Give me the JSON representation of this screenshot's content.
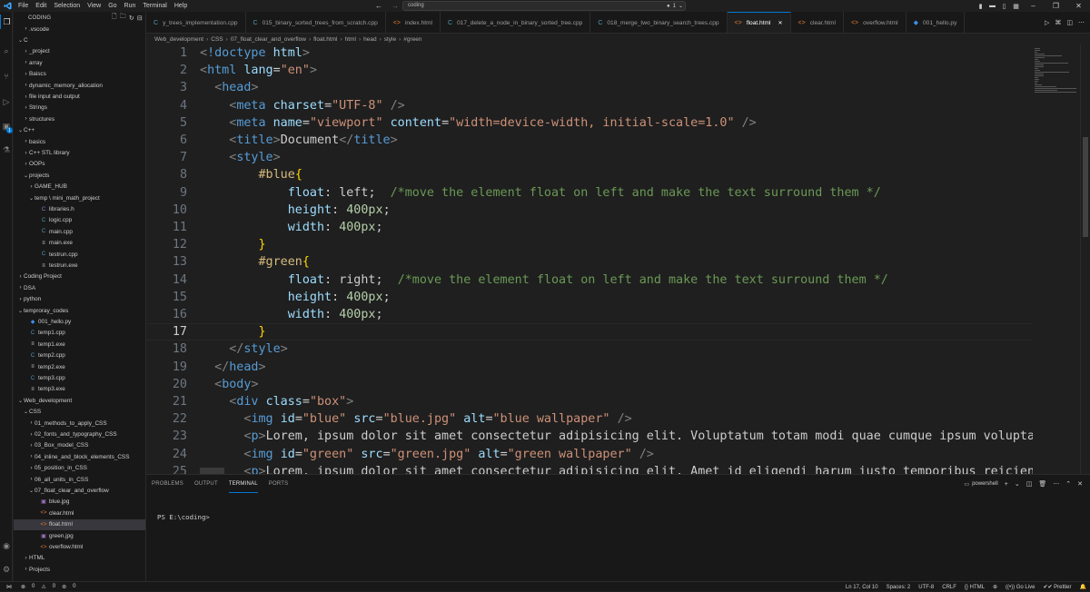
{
  "titlebar": {
    "menu": [
      "File",
      "Edit",
      "Selection",
      "View",
      "Go",
      "Run",
      "Terminal",
      "Help"
    ],
    "search_text": "coding",
    "copilot_count": "1",
    "back_icon": "arrow-left-icon",
    "forward_icon": "arrow-right-icon"
  },
  "activity": {
    "extensions_badge": "1"
  },
  "sidebar": {
    "title": "CODING",
    "items": [
      {
        "label": ".vscode",
        "depth": 1,
        "type": "folder",
        "open": false
      },
      {
        "label": "C",
        "depth": 0,
        "type": "folder",
        "open": true
      },
      {
        "label": "_project",
        "depth": 1,
        "type": "folder",
        "open": false
      },
      {
        "label": "array",
        "depth": 1,
        "type": "folder",
        "open": false
      },
      {
        "label": "Baiscs",
        "depth": 1,
        "type": "folder",
        "open": false
      },
      {
        "label": "dynamic_memory_allocation",
        "depth": 1,
        "type": "folder",
        "open": false
      },
      {
        "label": "file input and output",
        "depth": 1,
        "type": "folder",
        "open": false
      },
      {
        "label": "Strings",
        "depth": 1,
        "type": "folder",
        "open": false
      },
      {
        "label": "structures",
        "depth": 1,
        "type": "folder",
        "open": false
      },
      {
        "label": "C++",
        "depth": 0,
        "type": "folder",
        "open": true
      },
      {
        "label": "basics",
        "depth": 1,
        "type": "folder",
        "open": false
      },
      {
        "label": "C++ STL library",
        "depth": 1,
        "type": "folder",
        "open": false
      },
      {
        "label": "OOPs",
        "depth": 1,
        "type": "folder",
        "open": false
      },
      {
        "label": "projects",
        "depth": 1,
        "type": "folder",
        "open": true
      },
      {
        "label": "GAME_HUB",
        "depth": 2,
        "type": "folder",
        "open": false
      },
      {
        "label": "temp \\ mini_math_project",
        "depth": 2,
        "type": "folder",
        "open": true
      },
      {
        "label": "libraries.h",
        "depth": 3,
        "type": "h"
      },
      {
        "label": "logic.cpp",
        "depth": 3,
        "type": "cpp"
      },
      {
        "label": "main.cpp",
        "depth": 3,
        "type": "cpp"
      },
      {
        "label": "main.exe",
        "depth": 3,
        "type": "exe"
      },
      {
        "label": "testrun.cpp",
        "depth": 3,
        "type": "cpp"
      },
      {
        "label": "testrun.exe",
        "depth": 3,
        "type": "exe"
      },
      {
        "label": "Coding Project",
        "depth": 0,
        "type": "folder",
        "open": false
      },
      {
        "label": "DSA",
        "depth": 0,
        "type": "folder",
        "open": false
      },
      {
        "label": "python",
        "depth": 0,
        "type": "folder",
        "open": false
      },
      {
        "label": "temproray_codes",
        "depth": 0,
        "type": "folder",
        "open": true
      },
      {
        "label": "001_hello.py",
        "depth": 1,
        "type": "py"
      },
      {
        "label": "temp1.cpp",
        "depth": 1,
        "type": "cpp"
      },
      {
        "label": "temp1.exe",
        "depth": 1,
        "type": "exe"
      },
      {
        "label": "temp2.cpp",
        "depth": 1,
        "type": "cpp"
      },
      {
        "label": "temp2.exe",
        "depth": 1,
        "type": "exe"
      },
      {
        "label": "temp3.cpp",
        "depth": 1,
        "type": "cpp"
      },
      {
        "label": "temp3.exe",
        "depth": 1,
        "type": "exe"
      },
      {
        "label": "Web_development",
        "depth": 0,
        "type": "folder",
        "open": true
      },
      {
        "label": "CSS",
        "depth": 1,
        "type": "folder",
        "open": true
      },
      {
        "label": "01_methods_to_apply_CSS",
        "depth": 2,
        "type": "folder",
        "open": false
      },
      {
        "label": "02_fonts_and_typography_CSS",
        "depth": 2,
        "type": "folder",
        "open": false
      },
      {
        "label": "03_Box_model_CSS",
        "depth": 2,
        "type": "folder",
        "open": false
      },
      {
        "label": "04_inline_and_block_elements_CSS",
        "depth": 2,
        "type": "folder",
        "open": false
      },
      {
        "label": "05_position_in_CSS",
        "depth": 2,
        "type": "folder",
        "open": false
      },
      {
        "label": "06_all_units_in_CSS",
        "depth": 2,
        "type": "folder",
        "open": false
      },
      {
        "label": "07_float_clear_and_overflow",
        "depth": 2,
        "type": "folder",
        "open": true
      },
      {
        "label": "blue.jpg",
        "depth": 3,
        "type": "img"
      },
      {
        "label": "clear.html",
        "depth": 3,
        "type": "html"
      },
      {
        "label": "float.html",
        "depth": 3,
        "type": "html",
        "selected": true
      },
      {
        "label": "green.jpg",
        "depth": 3,
        "type": "img"
      },
      {
        "label": "overflow.html",
        "depth": 3,
        "type": "html"
      },
      {
        "label": "HTML",
        "depth": 1,
        "type": "folder",
        "open": false
      },
      {
        "label": "Projects",
        "depth": 1,
        "type": "folder",
        "open": false
      }
    ]
  },
  "tabs": [
    {
      "label": "y_trees_implementation.cpp",
      "icon": "cpp",
      "active": false
    },
    {
      "label": "015_binary_sorted_trees_from_scratch.cpp",
      "icon": "cpp",
      "active": false
    },
    {
      "label": "index.html",
      "icon": "html",
      "active": false
    },
    {
      "label": "017_delete_a_node_in_binary_sorted_tree.cpp",
      "icon": "cpp",
      "active": false
    },
    {
      "label": "018_merge_two_binary_search_trees.cpp",
      "icon": "cpp",
      "active": false
    },
    {
      "label": "float.html",
      "icon": "html",
      "active": true
    },
    {
      "label": "clear.html",
      "icon": "html",
      "active": false
    },
    {
      "label": "overflow.html",
      "icon": "html",
      "active": false
    },
    {
      "label": "001_hello.py",
      "icon": "py",
      "active": false
    }
  ],
  "breadcrumbs": [
    "Web_development",
    "CSS",
    "07_float_clear_and_overflow",
    "float.html",
    "html",
    "head",
    "style",
    "#green"
  ],
  "editor": {
    "current_line": 17,
    "lines": [
      {
        "n": "1",
        "tokens": [
          [
            "t-br",
            "<"
          ],
          [
            "t-doc",
            "!doctype"
          ],
          [
            "t-txt",
            " "
          ],
          [
            "t-attr",
            "html"
          ],
          [
            "t-br",
            ">"
          ]
        ]
      },
      {
        "n": "2",
        "tokens": [
          [
            "t-br",
            "<"
          ],
          [
            "t-tag",
            "html"
          ],
          [
            "t-txt",
            " "
          ],
          [
            "t-attr",
            "lang"
          ],
          [
            "t-txt",
            "="
          ],
          [
            "t-str",
            "\"en\""
          ],
          [
            "t-br",
            ">"
          ]
        ]
      },
      {
        "n": "3",
        "tokens": [
          [
            "t-txt",
            "  "
          ],
          [
            "t-br",
            "<"
          ],
          [
            "t-tag",
            "head"
          ],
          [
            "t-br",
            ">"
          ]
        ]
      },
      {
        "n": "4",
        "tokens": [
          [
            "t-txt",
            "    "
          ],
          [
            "t-br",
            "<"
          ],
          [
            "t-tag",
            "meta"
          ],
          [
            "t-txt",
            " "
          ],
          [
            "t-attr",
            "charset"
          ],
          [
            "t-txt",
            "="
          ],
          [
            "t-str",
            "\"UTF-8\""
          ],
          [
            "t-txt",
            " "
          ],
          [
            "t-br",
            "/>"
          ]
        ]
      },
      {
        "n": "5",
        "tokens": [
          [
            "t-txt",
            "    "
          ],
          [
            "t-br",
            "<"
          ],
          [
            "t-tag",
            "meta"
          ],
          [
            "t-txt",
            " "
          ],
          [
            "t-attr",
            "name"
          ],
          [
            "t-txt",
            "="
          ],
          [
            "t-str",
            "\"viewport\""
          ],
          [
            "t-txt",
            " "
          ],
          [
            "t-attr",
            "content"
          ],
          [
            "t-txt",
            "="
          ],
          [
            "t-str",
            "\"width=device-width, initial-scale=1.0\""
          ],
          [
            "t-txt",
            " "
          ],
          [
            "t-br",
            "/>"
          ]
        ]
      },
      {
        "n": "6",
        "tokens": [
          [
            "t-txt",
            "    "
          ],
          [
            "t-br",
            "<"
          ],
          [
            "t-tag",
            "title"
          ],
          [
            "t-br",
            ">"
          ],
          [
            "t-txt",
            "Document"
          ],
          [
            "t-br",
            "</"
          ],
          [
            "t-tag",
            "title"
          ],
          [
            "t-br",
            ">"
          ]
        ]
      },
      {
        "n": "7",
        "tokens": [
          [
            "t-txt",
            "    "
          ],
          [
            "t-br",
            "<"
          ],
          [
            "t-tag",
            "style"
          ],
          [
            "t-br",
            ">"
          ]
        ]
      },
      {
        "n": "8",
        "tokens": [
          [
            "t-txt",
            "        "
          ],
          [
            "t-sel",
            "#blue"
          ],
          [
            "t-brace",
            "{"
          ]
        ]
      },
      {
        "n": "9",
        "tokens": [
          [
            "t-txt",
            "            "
          ],
          [
            "t-prop",
            "float"
          ],
          [
            "t-txt",
            ": "
          ],
          [
            "t-txt",
            "left"
          ],
          [
            "t-txt",
            ";  "
          ],
          [
            "t-com",
            "/*move the element float on left and make the text surround them */"
          ]
        ]
      },
      {
        "n": "10",
        "tokens": [
          [
            "t-txt",
            "            "
          ],
          [
            "t-prop",
            "height"
          ],
          [
            "t-txt",
            ": "
          ],
          [
            "t-val",
            "400px"
          ],
          [
            "t-txt",
            ";"
          ]
        ]
      },
      {
        "n": "11",
        "tokens": [
          [
            "t-txt",
            "            "
          ],
          [
            "t-prop",
            "width"
          ],
          [
            "t-txt",
            ": "
          ],
          [
            "t-val",
            "400px"
          ],
          [
            "t-txt",
            ";"
          ]
        ]
      },
      {
        "n": "12",
        "tokens": [
          [
            "t-txt",
            "        "
          ],
          [
            "t-brace",
            "}"
          ]
        ]
      },
      {
        "n": "13",
        "tokens": [
          [
            "t-txt",
            "        "
          ],
          [
            "t-sel",
            "#green"
          ],
          [
            "t-brace",
            "{"
          ]
        ]
      },
      {
        "n": "14",
        "tokens": [
          [
            "t-txt",
            "            "
          ],
          [
            "t-prop",
            "float"
          ],
          [
            "t-txt",
            ": "
          ],
          [
            "t-txt",
            "right"
          ],
          [
            "t-txt",
            ";  "
          ],
          [
            "t-com",
            "/*move the element float on left and make the text surround them */"
          ]
        ]
      },
      {
        "n": "15",
        "tokens": [
          [
            "t-txt",
            "            "
          ],
          [
            "t-prop",
            "height"
          ],
          [
            "t-txt",
            ": "
          ],
          [
            "t-val",
            "400px"
          ],
          [
            "t-txt",
            ";"
          ]
        ]
      },
      {
        "n": "16",
        "tokens": [
          [
            "t-txt",
            "            "
          ],
          [
            "t-prop",
            "width"
          ],
          [
            "t-txt",
            ": "
          ],
          [
            "t-val",
            "400px"
          ],
          [
            "t-txt",
            ";"
          ]
        ]
      },
      {
        "n": "17",
        "tokens": [
          [
            "t-txt",
            "        "
          ],
          [
            "t-brace",
            "}"
          ]
        ]
      },
      {
        "n": "18",
        "tokens": [
          [
            "t-txt",
            "    "
          ],
          [
            "t-br",
            "</"
          ],
          [
            "t-tag",
            "style"
          ],
          [
            "t-br",
            ">"
          ]
        ]
      },
      {
        "n": "19",
        "tokens": [
          [
            "t-txt",
            "  "
          ],
          [
            "t-br",
            "</"
          ],
          [
            "t-tag",
            "head"
          ],
          [
            "t-br",
            ">"
          ]
        ]
      },
      {
        "n": "20",
        "tokens": [
          [
            "t-txt",
            "  "
          ],
          [
            "t-br",
            "<"
          ],
          [
            "t-tag",
            "body"
          ],
          [
            "t-br",
            ">"
          ]
        ]
      },
      {
        "n": "21",
        "tokens": [
          [
            "t-txt",
            "    "
          ],
          [
            "t-br",
            "<"
          ],
          [
            "t-tag",
            "div"
          ],
          [
            "t-txt",
            " "
          ],
          [
            "t-attr",
            "class"
          ],
          [
            "t-txt",
            "="
          ],
          [
            "t-str",
            "\"box\""
          ],
          [
            "t-br",
            ">"
          ]
        ]
      },
      {
        "n": "22",
        "tokens": [
          [
            "t-txt",
            "      "
          ],
          [
            "t-br",
            "<"
          ],
          [
            "t-tag",
            "img"
          ],
          [
            "t-txt",
            " "
          ],
          [
            "t-attr",
            "id"
          ],
          [
            "t-txt",
            "="
          ],
          [
            "t-str",
            "\"blue\""
          ],
          [
            "t-txt",
            " "
          ],
          [
            "t-attr",
            "src"
          ],
          [
            "t-txt",
            "="
          ],
          [
            "t-str",
            "\"blue.jpg\""
          ],
          [
            "t-txt",
            " "
          ],
          [
            "t-attr",
            "alt"
          ],
          [
            "t-txt",
            "="
          ],
          [
            "t-str",
            "\"blue wallpaper\""
          ],
          [
            "t-txt",
            " "
          ],
          [
            "t-br",
            "/>"
          ]
        ]
      },
      {
        "n": "23",
        "tokens": [
          [
            "t-txt",
            "      "
          ],
          [
            "t-br",
            "<"
          ],
          [
            "t-tag",
            "p"
          ],
          [
            "t-br",
            ">"
          ],
          [
            "t-txt",
            "Lorem, ipsum dolor sit amet consectetur adipisicing elit. Voluptatum totam modi quae cumque ipsum voluptates natus,"
          ]
        ]
      },
      {
        "n": "24",
        "tokens": [
          [
            "t-txt",
            "      "
          ],
          [
            "t-br",
            "<"
          ],
          [
            "t-tag",
            "img"
          ],
          [
            "t-txt",
            " "
          ],
          [
            "t-attr",
            "id"
          ],
          [
            "t-txt",
            "="
          ],
          [
            "t-str",
            "\"green\""
          ],
          [
            "t-txt",
            " "
          ],
          [
            "t-attr",
            "src"
          ],
          [
            "t-txt",
            "="
          ],
          [
            "t-str",
            "\"green.jpg\""
          ],
          [
            "t-txt",
            " "
          ],
          [
            "t-attr",
            "alt"
          ],
          [
            "t-txt",
            "="
          ],
          [
            "t-str",
            "\"green wallpaper\""
          ],
          [
            "t-txt",
            " "
          ],
          [
            "t-br",
            "/>"
          ]
        ]
      },
      {
        "n": "25",
        "tokens": [
          [
            "t-txt",
            "      "
          ],
          [
            "t-br",
            "<"
          ],
          [
            "t-tag",
            "p"
          ],
          [
            "t-br",
            ">"
          ],
          [
            "t-txt",
            "Lorem, ipsum dolor sit amet consectetur adipisicing elit. Amet id eligendi harum iusto temporibus reiciendis dolorib"
          ]
        ]
      }
    ]
  },
  "panel": {
    "tabs": [
      "PROBLEMS",
      "OUTPUT",
      "TERMINAL",
      "PORTS"
    ],
    "active_tab": "TERMINAL",
    "shell": "powershell",
    "prompt": "PS E:\\coding>"
  },
  "statusbar": {
    "errors": "0",
    "warnings": "0",
    "ports": "0",
    "position": "Ln 17, Col 10",
    "spaces": "Spaces: 2",
    "encoding": "UTF-8",
    "eol": "CRLF",
    "language": "HTML",
    "live": "Go Live",
    "prettier": "Prettier"
  }
}
